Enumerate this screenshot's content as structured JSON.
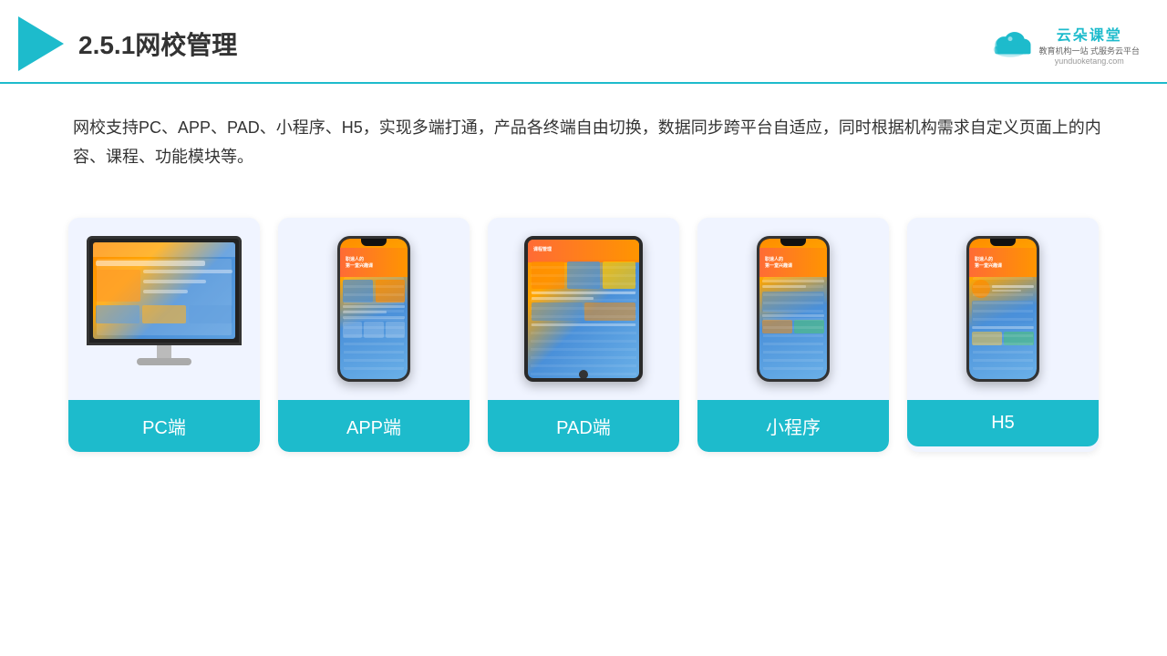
{
  "header": {
    "title": "2.5.1网校管理",
    "brand_name": "云朵课堂",
    "brand_url": "yunduoketang.com",
    "brand_tagline": "教育机构一站",
    "brand_tagline2": "式服务云平台"
  },
  "description": {
    "text": "网校支持PC、APP、PAD、小程序、H5，实现多端打通，产品各终端自由切换，数据同步跨平台自适应，同时根据机构需求自定义页面上的内容、课程、功能模块等。"
  },
  "cards": [
    {
      "id": "pc",
      "label": "PC端"
    },
    {
      "id": "app",
      "label": "APP端"
    },
    {
      "id": "pad",
      "label": "PAD端"
    },
    {
      "id": "miniapp",
      "label": "小程序"
    },
    {
      "id": "h5",
      "label": "H5"
    }
  ]
}
